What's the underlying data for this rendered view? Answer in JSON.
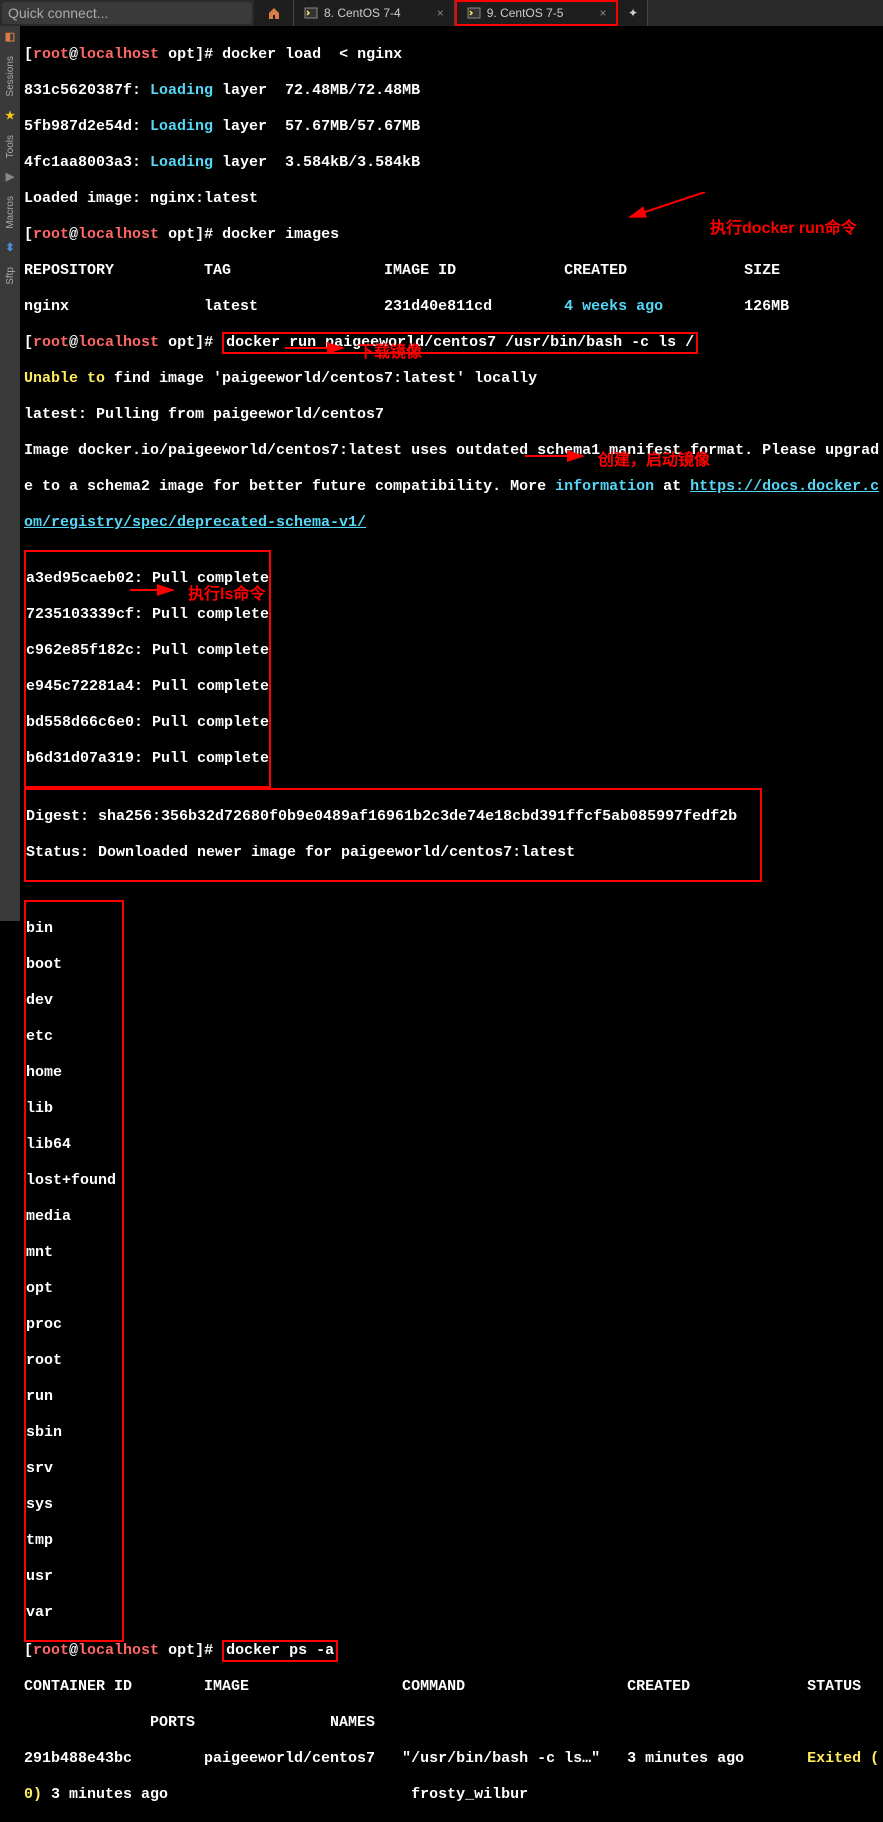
{
  "topbar": {
    "quick_connect": "Quick connect...",
    "tabs": [
      {
        "label": "8. CentOS 7-4"
      },
      {
        "label": "9. CentOS 7-5"
      }
    ]
  },
  "sidebar": {
    "items": [
      "Sessions",
      "Tools",
      "Macros",
      "Sftp"
    ]
  },
  "prompt": {
    "open": "[",
    "user": "root",
    "at": "@",
    "host": "localhost",
    "path": " opt",
    "close": "]# "
  },
  "lines": {
    "cmd1": "docker load  < nginx",
    "l2a": "831c5620387f: ",
    "l2b": "Loading",
    "l2c": " layer  72.48MB/72.48MB",
    "l3a": "5fb987d2e54d: ",
    "l3b": "Loading",
    "l3c": " layer  57.67MB/57.67MB",
    "l4a": "4fc1aa8003a3: ",
    "l4b": "Loading",
    "l4c": " layer  3.584kB/3.584kB",
    "l5": "Loaded image: nginx:latest",
    "cmd2": "docker images",
    "hdr": "REPOSITORY          TAG                 IMAGE ID            CREATED             SIZE",
    "row1a": "nginx               latest              231d40e811cd        ",
    "row1b": "4 weeks ago",
    "row1c": "         126MB",
    "cmd3": "docker run paigeeworld/centos7 /usr/bin/bash -c ls /",
    "l10a": "Unable to",
    "l10b": " find image 'paigeeworld/centos7:latest' locally",
    "l11": "latest: Pulling from paigeeworld/centos7",
    "l12a": "Image docker.io/paigeeworld/centos7:latest uses outdated schema1 manifest format. Please upgrad",
    "l12b": "e to a schema2 image for better future compatibility. More ",
    "l12c": "information",
    "l12d": " at ",
    "l12e": "https://docs.docker.c",
    "l12f": "om/registry/spec/deprecated-schema-v1/",
    "pull1": "a3ed95caeb02: Pull complete",
    "pull2": "7235103339cf: Pull complete",
    "pull3": "c962e85f182c: Pull complete",
    "pull4": "e945c72281a4: Pull complete",
    "pull5": "bd558d66c6e0: Pull complete",
    "pull6": "b6d31d07a319: Pull complete",
    "digest": "Digest: sha256:356b32d72680f0b9e0489af16961b2c3de74e18cbd391ffcf5ab085997fedf2b",
    "status": "Status: Downloaded newer image for paigeeworld/centos7:latest",
    "dirs": [
      "bin",
      "boot",
      "dev",
      "etc",
      "home",
      "lib",
      "lib64",
      "lost+found",
      "media",
      "mnt",
      "opt",
      "proc",
      "root",
      "run",
      "sbin",
      "srv",
      "sys",
      "tmp",
      "usr",
      "var"
    ],
    "cmd4": "docker ps -a",
    "pshdr1": "CONTAINER ID        IMAGE                 COMMAND                  CREATED             STATUS",
    "pshdr2": "              PORTS               NAMES",
    "psrow1a": "291b488e43bc        paigeeworld/centos7   \"/usr/bin/bash -c ls…\"   3 minutes ago       ",
    "psrow1b": "Exited (",
    "psrow2a": "0)",
    "psrow2b": " 3 minutes ago                           frosty_wilbur"
  },
  "annotations": {
    "a1": "执行docker run命令",
    "a2": "下载镜像",
    "a3": "创建，启动镜像",
    "a4": "执行ls命令"
  }
}
